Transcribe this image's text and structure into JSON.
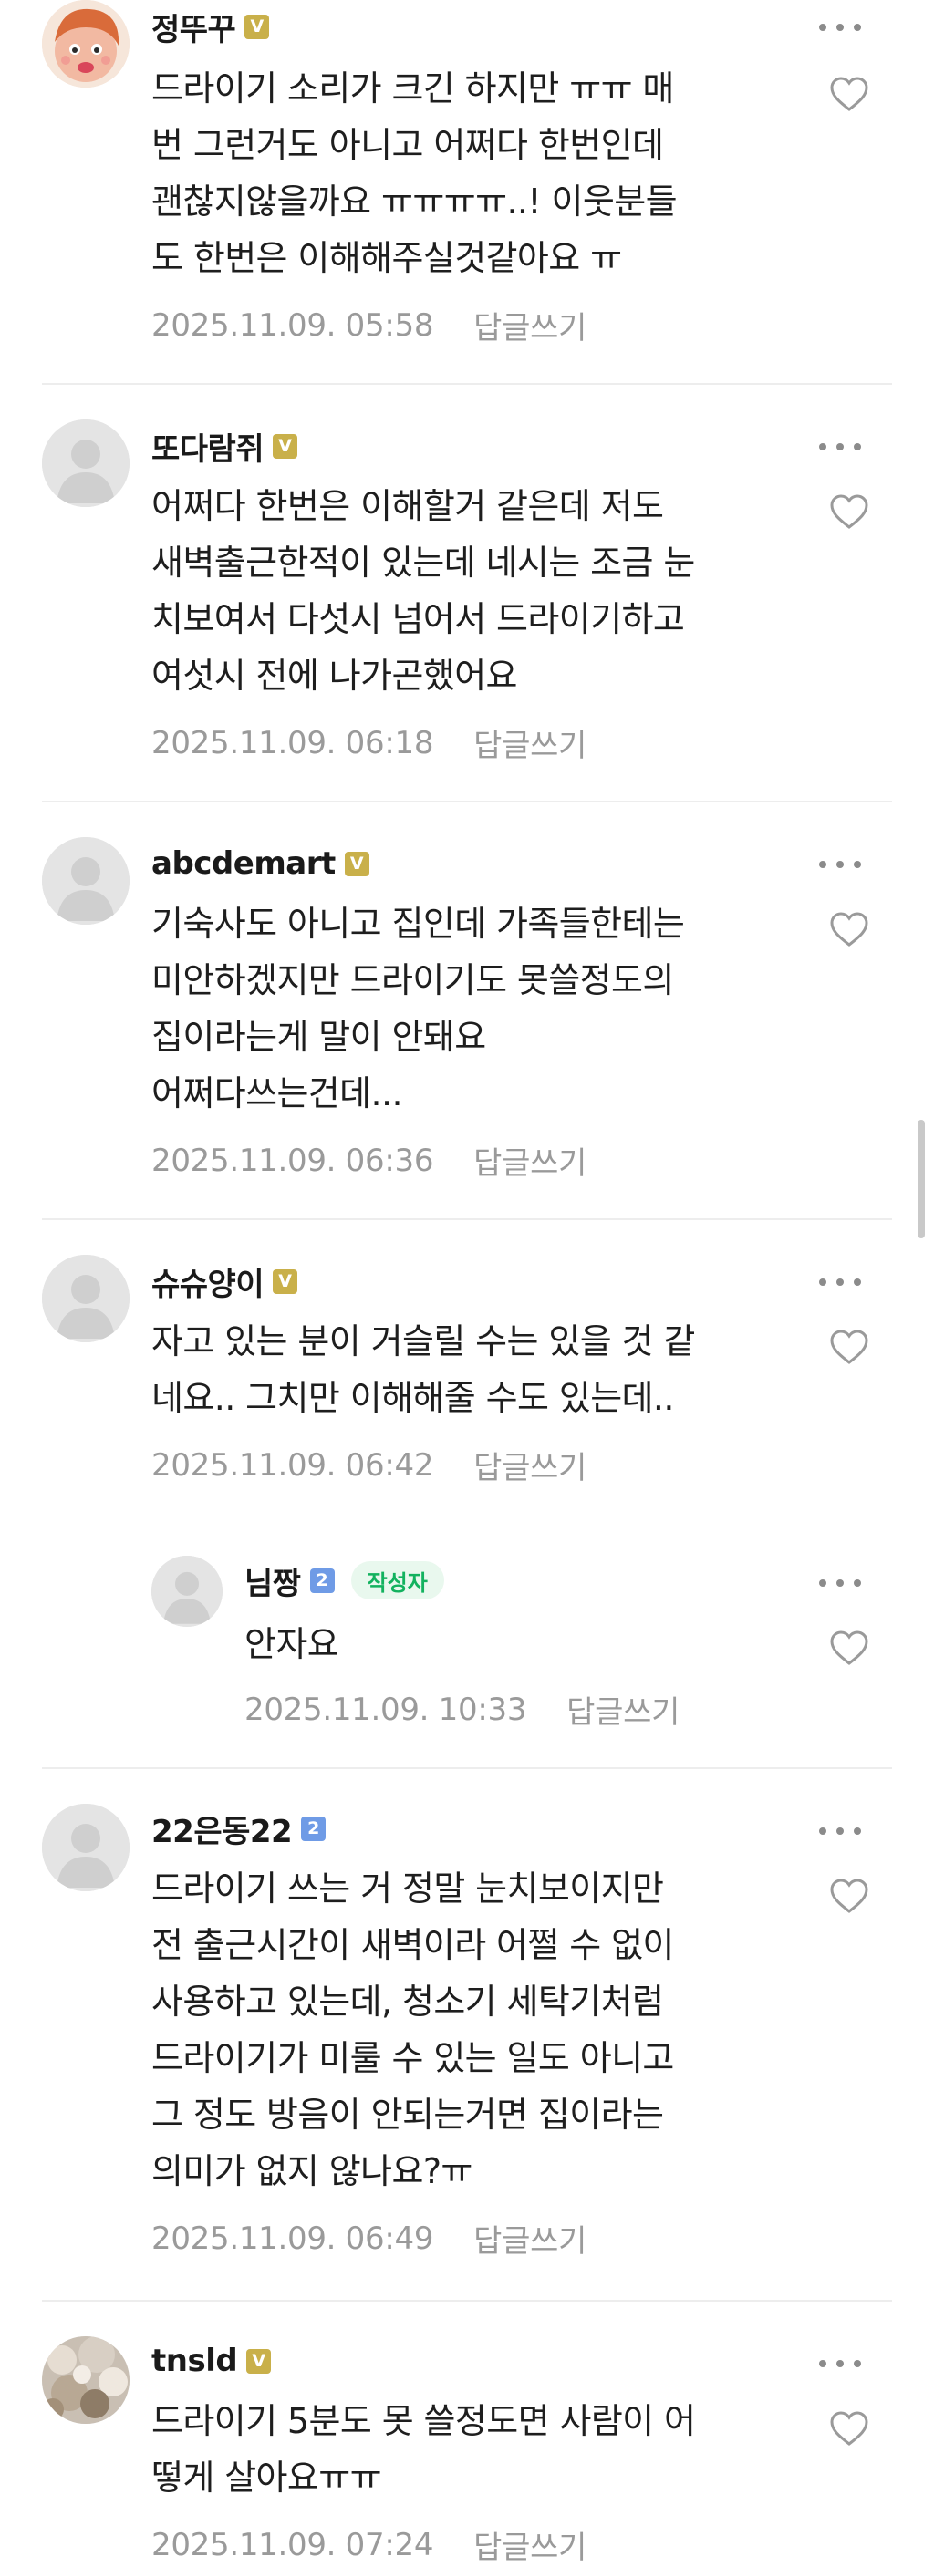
{
  "comments": [
    {
      "nickname": "정뚜꾸",
      "badge": "V",
      "avatar": "cartoon-character-avatar",
      "lines": [
        "드라이기 소리가 크긴 하지만 ㅠㅠ 매",
        "번 그런거도 아니고 어쩌다 한번인데",
        "괜찮지않을까요 ㅠㅠㅠㅠ..! 이웃분들",
        "도 한번은 이해해주실것같아요 ㅠ"
      ],
      "date": "2025.11.09. 05:58",
      "reply_label": "답글쓰기"
    },
    {
      "nickname": "또다람쥐",
      "badge": "V",
      "avatar": "default-profile",
      "lines": [
        "어쩌다 한번은 이해할거 같은데 저도",
        "새벽출근한적이 있는데 네시는 조금 눈",
        "치보여서 다섯시 넘어서 드라이기하고",
        "여섯시 전에 나가곤했어요"
      ],
      "date": "2025.11.09. 06:18",
      "reply_label": "답글쓰기"
    },
    {
      "nickname": "abcdemart",
      "badge": "V",
      "avatar": "default-profile",
      "lines": [
        "기숙사도 아니고 집인데 가족들한테는",
        "미안하겠지만 드라이기도 못쓸정도의",
        "집이라는게 말이 안돼요",
        "어쩌다쓰는건데..."
      ],
      "date": "2025.11.09. 06:36",
      "reply_label": "답글쓰기"
    },
    {
      "nickname": "슈슈양이",
      "badge": "V",
      "avatar": "default-profile",
      "lines": [
        "자고 있는 분이 거슬릴 수는 있을 것 같",
        "네요.. 그치만 이해해줄 수도 있는데.."
      ],
      "date": "2025.11.09. 06:42",
      "reply_label": "답글쓰기"
    },
    {
      "nickname": "님짱",
      "badge": "2",
      "writer_tag": "작성자",
      "avatar": "default-profile",
      "lines": [
        "안자요"
      ],
      "date": "2025.11.09. 10:33",
      "reply_label": "답글쓰기"
    },
    {
      "nickname": "22은동22",
      "badge": "2",
      "avatar": "default-profile",
      "lines": [
        "드라이기 쓰는 거 정말 눈치보이지만",
        "전 출근시간이 새벽이라 어쩔 수 없이",
        "사용하고 있는데, 청소기 세탁기처럼",
        "드라이기가 미룰 수 있는 일도 아니고",
        "그 정도 방음이 안되는거면 집이라는",
        "의미가 없지 않나요?ㅠ"
      ],
      "date": "2025.11.09. 06:49",
      "reply_label": "답글쓰기"
    },
    {
      "nickname": "tnsld",
      "badge": "V",
      "avatar": "nature-photo-avatar",
      "lines": [
        "드라이기 5분도 못 쓸정도면 사람이 어",
        "떻게 살아요ㅠㅠ"
      ],
      "date": "2025.11.09. 07:24",
      "reply_label": "답글쓰기"
    }
  ],
  "icons": {
    "more": "more-dots-icon",
    "like": "heart-outline-icon"
  },
  "colors": {
    "badge_v": "#c9b04a",
    "badge_level": "#6f9be6",
    "writer_tag_text": "#13b25f",
    "writer_tag_bg": "#e9f8ee",
    "meta_gray": "#9a9a9a"
  }
}
